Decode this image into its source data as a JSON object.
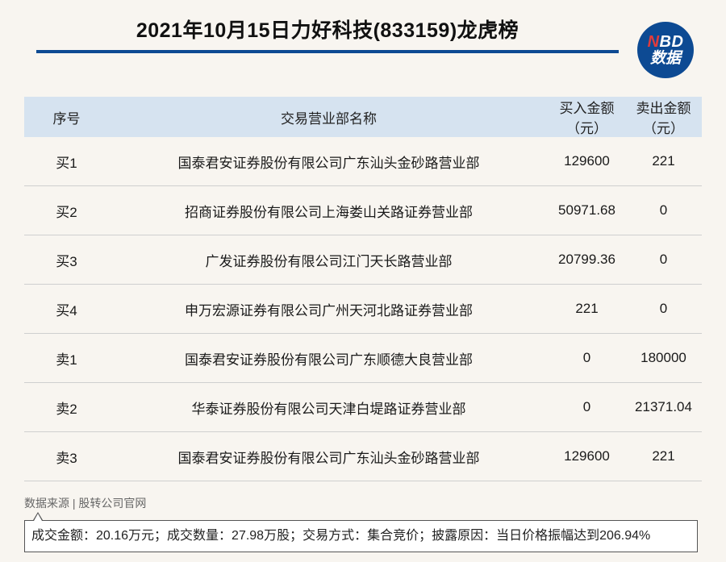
{
  "title": "2021年10月15日力好科技(833159)龙虎榜",
  "logo": {
    "line1_n": "N",
    "line1_rest": "BD",
    "line2": "数据"
  },
  "colors": {
    "accent": "#0d4a93",
    "header_bg": "#d6e3f0",
    "logo_n": "#e23b3b"
  },
  "table": {
    "headers": [
      "序号",
      "交易营业部名称",
      "买入金额（元）",
      "卖出金额（元）"
    ],
    "rows": [
      {
        "idx": "买1",
        "name": "国泰君安证券股份有限公司广东汕头金砂路营业部",
        "buy": "129600",
        "sell": "221"
      },
      {
        "idx": "买2",
        "name": "招商证券股份有限公司上海娄山关路证券营业部",
        "buy": "50971.68",
        "sell": "0"
      },
      {
        "idx": "买3",
        "name": "广发证券股份有限公司江门天长路营业部",
        "buy": "20799.36",
        "sell": "0"
      },
      {
        "idx": "买4",
        "name": "申万宏源证券有限公司广州天河北路证券营业部",
        "buy": "221",
        "sell": "0"
      },
      {
        "idx": "卖1",
        "name": "国泰君安证券股份有限公司广东顺德大良营业部",
        "buy": "0",
        "sell": "180000"
      },
      {
        "idx": "卖2",
        "name": "华泰证券股份有限公司天津白堤路证券营业部",
        "buy": "0",
        "sell": "21371.04"
      },
      {
        "idx": "卖3",
        "name": "国泰君安证券股份有限公司广东汕头金砂路营业部",
        "buy": "129600",
        "sell": "221"
      }
    ]
  },
  "source": "数据来源 | 股转公司官网",
  "note": "成交金额：20.16万元；成交数量：27.98万股；交易方式：集合竞价；披露原因：当日价格振幅达到206.94%"
}
